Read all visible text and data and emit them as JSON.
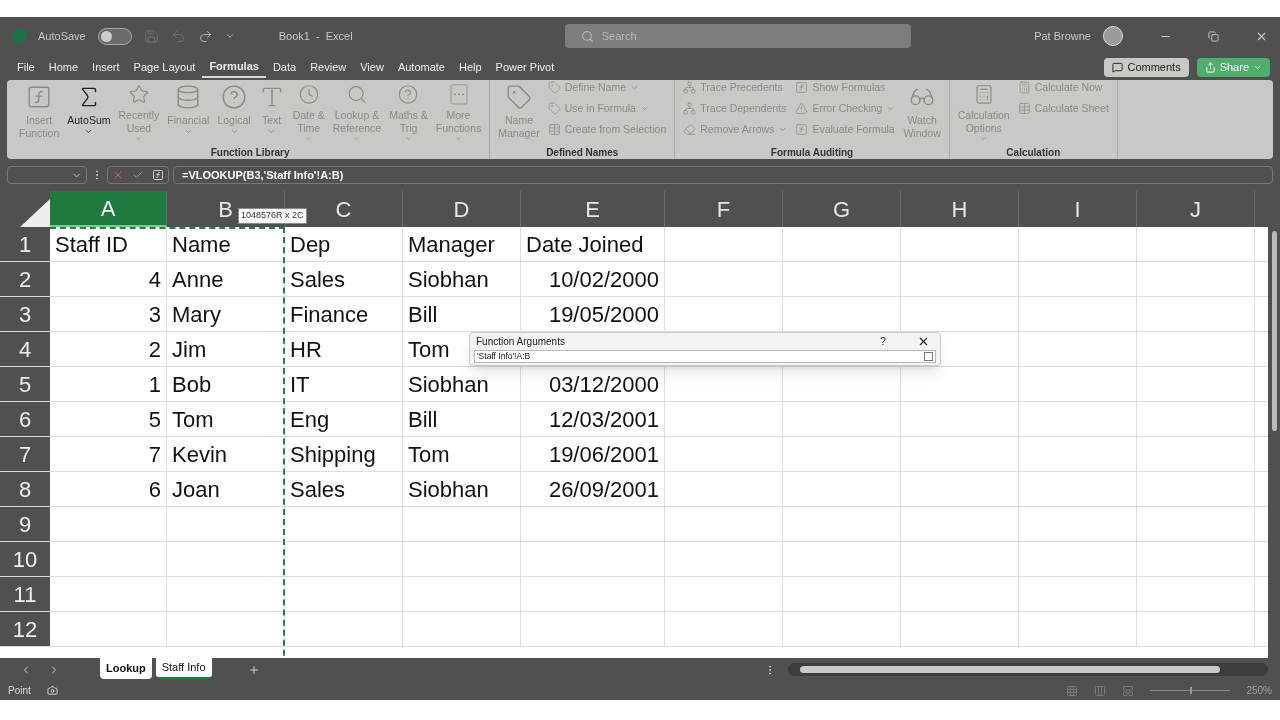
{
  "window": {
    "title": "Book1  -  Excel",
    "autosave": {
      "label": "AutoSave",
      "on": false
    },
    "search": {
      "placeholder": "Search"
    },
    "user": "Pat Browne"
  },
  "menu": [
    {
      "label": "File",
      "selected": false
    },
    {
      "label": "Home",
      "selected": false
    },
    {
      "label": "Insert",
      "selected": false
    },
    {
      "label": "Page Layout",
      "selected": false
    },
    {
      "label": "Formulas",
      "selected": true
    },
    {
      "label": "Data",
      "selected": false
    },
    {
      "label": "Review",
      "selected": false
    },
    {
      "label": "View",
      "selected": false
    },
    {
      "label": "Automate",
      "selected": false
    },
    {
      "label": "Help",
      "selected": false
    },
    {
      "label": "Power Pivot",
      "selected": false
    }
  ],
  "actions": {
    "comments": "Comments",
    "share": "Share"
  },
  "ribbon": [
    {
      "title": "Function Library",
      "items": [
        {
          "kind": "big",
          "lines": [
            "Insert",
            "Function"
          ],
          "dropdown": false,
          "disabled": true
        },
        {
          "kind": "big",
          "lines": [
            "AutoSum"
          ],
          "dropdown": true,
          "disabled": false
        },
        {
          "kind": "big",
          "lines": [
            "Recently",
            "Used"
          ],
          "dropdown": true,
          "disabled": true
        },
        {
          "kind": "big",
          "lines": [
            "Financial"
          ],
          "dropdown": true,
          "disabled": true
        },
        {
          "kind": "big",
          "lines": [
            "Logical"
          ],
          "dropdown": true,
          "disabled": true
        },
        {
          "kind": "big",
          "lines": [
            "Text"
          ],
          "dropdown": true,
          "disabled": true
        },
        {
          "kind": "big",
          "lines": [
            "Date &",
            "Time"
          ],
          "dropdown": true,
          "disabled": true
        },
        {
          "kind": "big",
          "lines": [
            "Lookup &",
            "Reference"
          ],
          "dropdown": true,
          "disabled": true
        },
        {
          "kind": "big",
          "lines": [
            "Maths &",
            "Trig"
          ],
          "dropdown": true,
          "disabled": true
        },
        {
          "kind": "big",
          "lines": [
            "More",
            "Functions"
          ],
          "dropdown": true,
          "disabled": true
        }
      ]
    },
    {
      "title": "Defined Names",
      "items": [
        {
          "kind": "big",
          "lines": [
            "Name",
            "Manager"
          ],
          "dropdown": false,
          "disabled": true
        },
        {
          "kind": "column",
          "items": [
            {
              "label": "Define Name",
              "dropdown": true
            },
            {
              "label": "Use in Formula",
              "dropdown": true
            },
            {
              "label": "Create from Selection",
              "dropdown": false
            }
          ]
        }
      ]
    },
    {
      "title": "Formula Auditing",
      "items": [
        {
          "kind": "column",
          "items": [
            {
              "label": "Trace Precedents",
              "dropdown": false
            },
            {
              "label": "Trace Dependents",
              "dropdown": false
            },
            {
              "label": "Remove Arrows",
              "dropdown": true
            }
          ]
        },
        {
          "kind": "column",
          "items": [
            {
              "label": "Show Formulas",
              "dropdown": false
            },
            {
              "label": "Error Checking",
              "dropdown": true
            },
            {
              "label": "Evaluate Formula",
              "dropdown": false
            }
          ]
        },
        {
          "kind": "big",
          "lines": [
            "Watch",
            "Window"
          ],
          "dropdown": false,
          "disabled": true
        }
      ]
    },
    {
      "title": "Calculation",
      "items": [
        {
          "kind": "big",
          "lines": [
            "Calculation",
            "Options"
          ],
          "dropdown": true,
          "disabled": true
        },
        {
          "kind": "column",
          "items": [
            {
              "label": "Calculate Now",
              "dropdown": false
            },
            {
              "label": "Calculate Sheet",
              "dropdown": false
            }
          ]
        }
      ]
    }
  ],
  "formula_bar": {
    "formula": "=VLOOKUP(B3,'Staff Info'!A:B)"
  },
  "columns": [
    {
      "label": "A",
      "selected": true
    },
    {
      "label": "B",
      "selected": false
    },
    {
      "label": "C",
      "selected": false
    },
    {
      "label": "D",
      "selected": false
    },
    {
      "label": "E",
      "selected": false
    },
    {
      "label": "F",
      "selected": false
    },
    {
      "label": "G",
      "selected": false
    },
    {
      "label": "H",
      "selected": false
    },
    {
      "label": "I",
      "selected": false
    },
    {
      "label": "J",
      "selected": false
    }
  ],
  "size_tip": "1048576R x 2C",
  "rows": [
    {
      "label": "1",
      "cells": [
        "Staff ID",
        "Name",
        "Dep",
        "Manager",
        "Date Joined"
      ]
    },
    {
      "label": "2",
      "cells": [
        "4",
        "Anne",
        "Sales",
        "Siobhan",
        "10/02/2000"
      ]
    },
    {
      "label": "3",
      "cells": [
        "3",
        "Mary",
        "Finance",
        "Bill",
        "19/05/2000"
      ]
    },
    {
      "label": "4",
      "cells": [
        "2",
        "Jim",
        "HR",
        "Tom",
        ""
      ]
    },
    {
      "label": "5",
      "cells": [
        "1",
        "Bob",
        "IT",
        "Siobhan",
        "03/12/2000"
      ]
    },
    {
      "label": "6",
      "cells": [
        "5",
        "Tom",
        "Eng",
        "Bill",
        "12/03/2001"
      ]
    },
    {
      "label": "7",
      "cells": [
        "7",
        "Kevin",
        "Shipping",
        "Tom",
        "19/06/2001"
      ]
    },
    {
      "label": "8",
      "cells": [
        "6",
        "Joan",
        "Sales",
        "Siobhan",
        "26/09/2001"
      ]
    },
    {
      "label": "9",
      "cells": []
    },
    {
      "label": "10",
      "cells": []
    },
    {
      "label": "11",
      "cells": []
    },
    {
      "label": "12",
      "cells": []
    }
  ],
  "dialog": {
    "title": "Function Arguments",
    "help": "?",
    "value": "'Staff Info'!A:B"
  },
  "sheets": [
    {
      "label": "Lookup",
      "selected": false
    },
    {
      "label": "Staff Info",
      "selected": true
    }
  ],
  "status": {
    "mode": "Point",
    "zoom": "250%",
    "zoom_slider": {
      "level": 0.5
    }
  }
}
